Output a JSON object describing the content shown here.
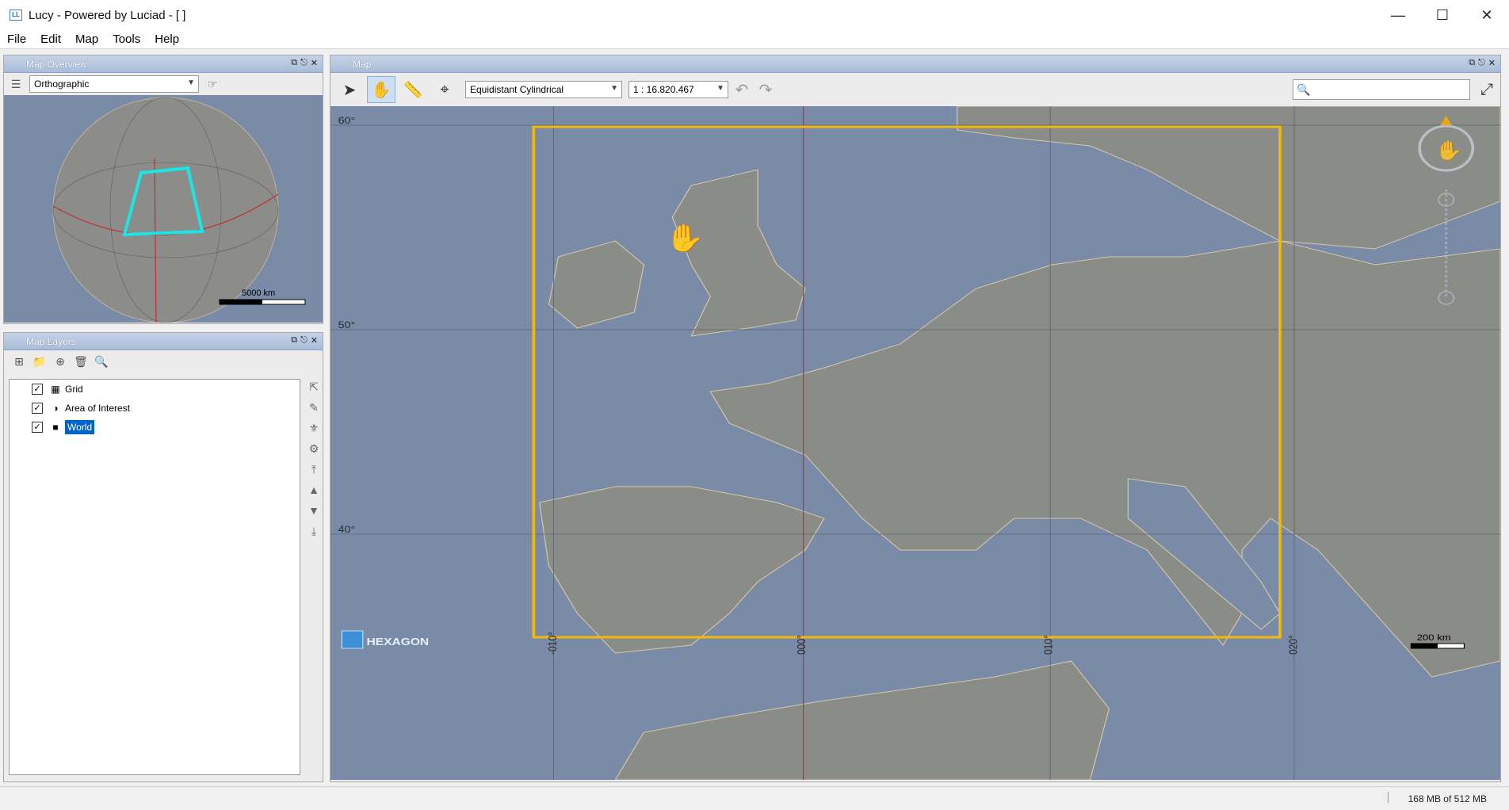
{
  "window": {
    "title": "Lucy - Powered by Luciad - [ ]",
    "icon_label": "LL"
  },
  "menu": [
    "File",
    "Edit",
    "Map",
    "Tools",
    "Help"
  ],
  "overview": {
    "title": "Map Overview",
    "projection": "Orthographic",
    "scale_label": "5000 km"
  },
  "layers": {
    "title": "Map Layers",
    "items": [
      {
        "label": "Grid",
        "checked": true,
        "icon": "grid-icon"
      },
      {
        "label": "Area of Interest",
        "checked": true,
        "icon": "globe-icon"
      },
      {
        "label": "World",
        "checked": true,
        "icon": "world-icon",
        "selected": true
      }
    ]
  },
  "map": {
    "title": "Map",
    "projection": "Equidistant Cylindrical",
    "scale": "1 : 16.820.467",
    "lat_labels": [
      "60°",
      "50°",
      "40°"
    ],
    "lon_labels": [
      "-010°",
      "000°",
      "010°",
      "020°"
    ],
    "scale_label": "200 km",
    "brand": "HEXAGON"
  },
  "status": {
    "memory": "168 MB of 512 MB"
  }
}
